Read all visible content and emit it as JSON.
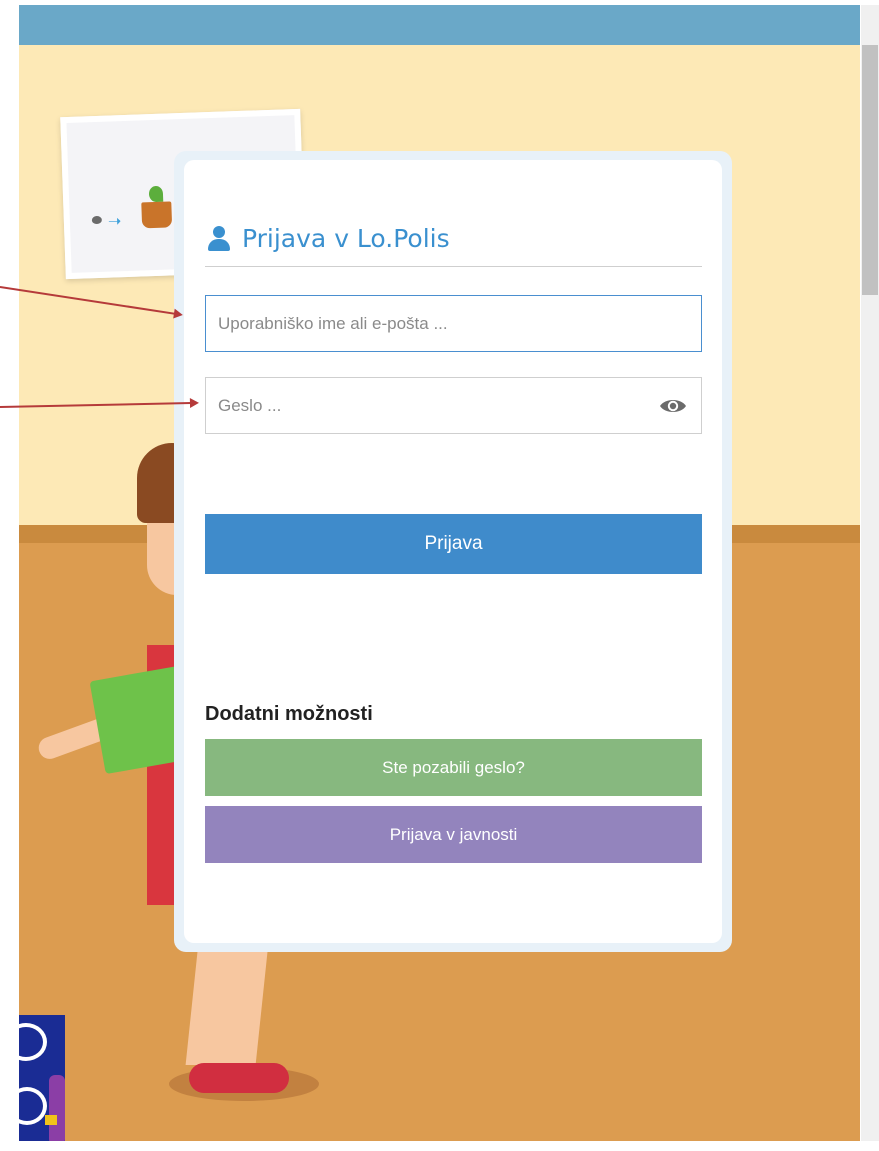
{
  "card": {
    "title": "Prijava v Lo.Polis",
    "username_placeholder": "Uporabniško ime ali e-pošta ...",
    "password_placeholder": "Geslo ...",
    "login_button": "Prijava",
    "extra_heading": "Dodatni možnosti",
    "forgot_button": "Ste pozabili geslo?",
    "public_button": "Prijava v javnosti"
  },
  "icons": {
    "title_icon": "user-icon",
    "password_toggle": "eye-icon"
  },
  "colors": {
    "accent": "#3a90cf",
    "login_button": "#3f8bcb",
    "forgot_button": "#87b87f",
    "public_button": "#9384bd",
    "top_bar": "#6aa8c8",
    "annotation_arrow": "#b53a3a"
  }
}
